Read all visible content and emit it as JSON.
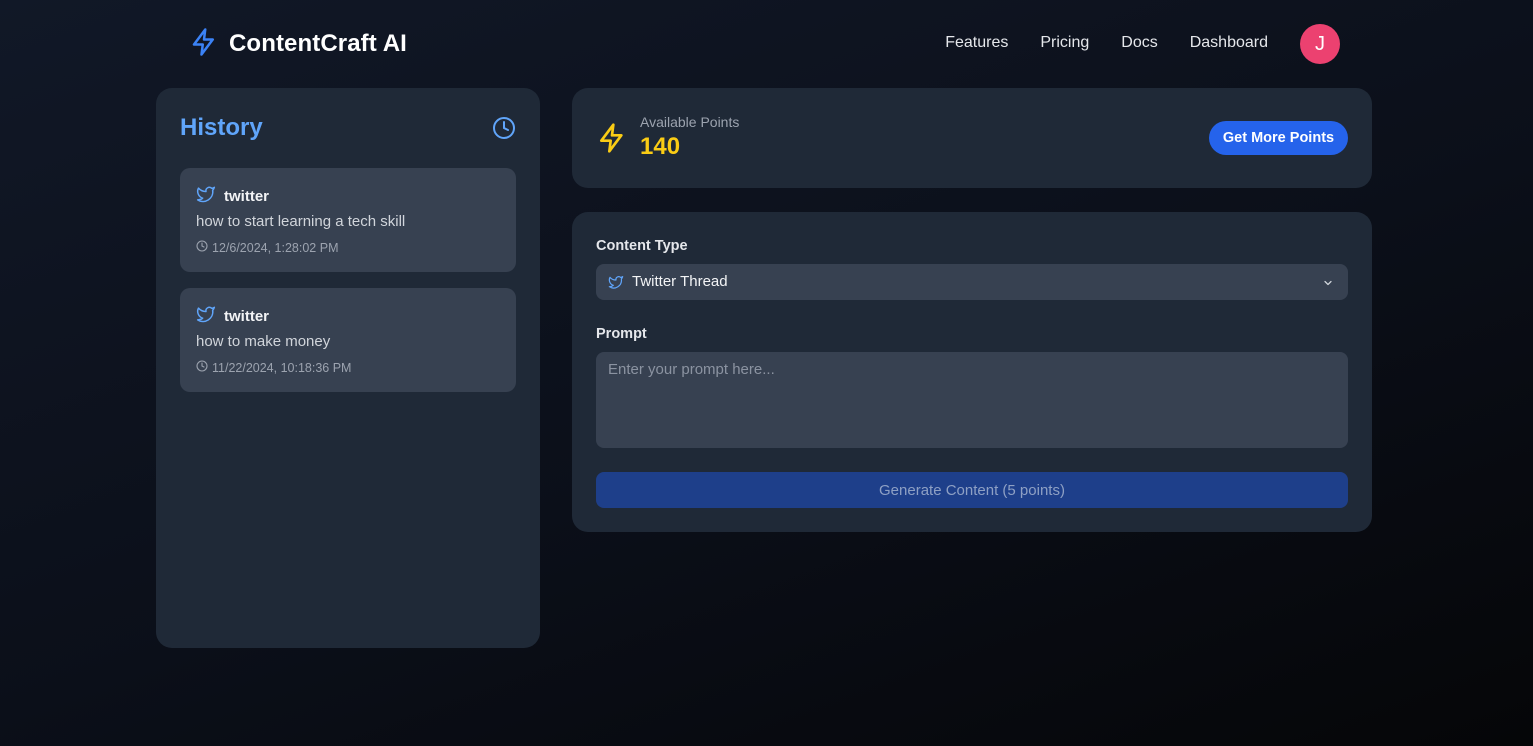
{
  "brand": {
    "name": "ContentCraft AI",
    "icon": "lightning-bolt-icon"
  },
  "nav": {
    "items": [
      "Features",
      "Pricing",
      "Docs",
      "Dashboard"
    ]
  },
  "user": {
    "avatar_initial": "J",
    "avatar_color": "#ec4170"
  },
  "history": {
    "title": "History",
    "items": [
      {
        "platform": "twitter",
        "prompt": "how to start learning a tech skill",
        "time": "12/6/2024, 1:28:02 PM"
      },
      {
        "platform": "twitter",
        "prompt": "how to make money",
        "time": "11/22/2024, 10:18:36 PM"
      }
    ]
  },
  "points": {
    "label": "Available Points",
    "value": "140",
    "button": "Get More Points"
  },
  "form": {
    "content_type_label": "Content Type",
    "content_type_value": "Twitter Thread",
    "prompt_label": "Prompt",
    "prompt_placeholder": "Enter your prompt here...",
    "prompt_value": "",
    "generate_label": "Generate Content (5 points)"
  },
  "colors": {
    "accent": "#2563eb",
    "history_title": "#60a5fa",
    "points": "#facc15",
    "panel": "#1f2937",
    "card": "#374151"
  }
}
